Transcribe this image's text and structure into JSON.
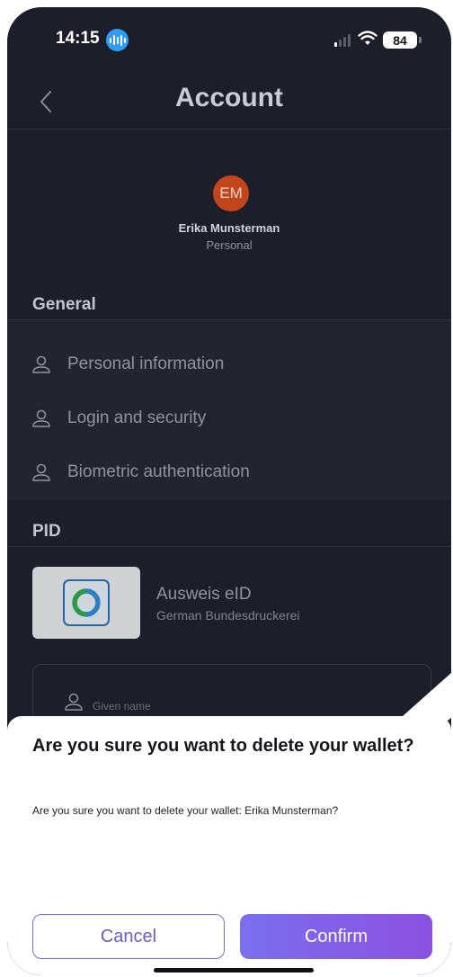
{
  "status_bar": {
    "time": "14:15",
    "battery": "84"
  },
  "header": {
    "title": "Account"
  },
  "profile": {
    "initials": "EM",
    "name": "Erika Munsterman",
    "type": "Personal"
  },
  "sections": {
    "general": "General",
    "pid": "PID"
  },
  "general_items": [
    {
      "label": "Personal information",
      "icon": "user-icon"
    },
    {
      "label": "Login and security",
      "icon": "user-icon"
    },
    {
      "label": "Biometric authentication",
      "icon": "user-icon"
    }
  ],
  "pid": {
    "title": "Ausweis eID",
    "issuer": "German Bundesdruckerei",
    "field_label": "Given name"
  },
  "dialog": {
    "title": "Are you sure you want to delete your wallet?",
    "message": "Are you sure you want to delete your wallet: Erika Munsterman?",
    "cancel_label": "Cancel",
    "confirm_label": "Confirm"
  },
  "colors": {
    "background": "#1c1f2a",
    "avatar": "#c2451c",
    "accent": "#7b6ff0"
  }
}
